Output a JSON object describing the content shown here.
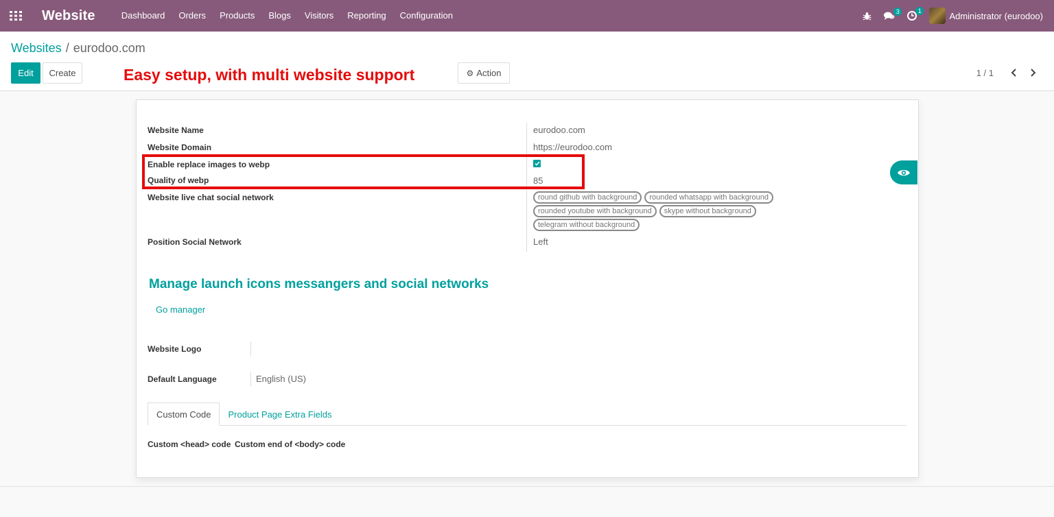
{
  "navbar": {
    "brand": "Website",
    "menu": [
      "Dashboard",
      "Orders",
      "Products",
      "Blogs",
      "Visitors",
      "Reporting",
      "Configuration"
    ],
    "messages_count": "3",
    "activities_count": "1",
    "user": "Administrator (eurodoo)"
  },
  "control_panel": {
    "breadcrumb_parent": "Websites",
    "breadcrumb_sep": "/",
    "breadcrumb_current": "eurodoo.com",
    "edit_label": "Edit",
    "create_label": "Create",
    "promo_text": "Easy setup, with multi website support",
    "action_label": "Action",
    "pager": "1 / 1"
  },
  "form": {
    "fields": [
      {
        "label": "Website Name",
        "value": "eurodoo.com"
      },
      {
        "label": "Website Domain",
        "value": "https://eurodoo.com"
      },
      {
        "label": "Enable replace images to webp",
        "checked": true
      },
      {
        "label": "Quality of webp",
        "value": "85"
      },
      {
        "label": "Website live chat social network"
      },
      {
        "label": "Position Social Network",
        "value": "Left"
      }
    ],
    "social_tags": [
      "round github with background",
      "rounded whatsapp with background",
      "rounded youtube with background",
      "skype without background",
      "telegram without background"
    ],
    "section_title": "Manage launch icons messangers and social networks",
    "go_manager": "Go manager",
    "logo_label": "Website Logo",
    "language_label": "Default Language",
    "language_value": "English (US)",
    "tabs": [
      "Custom Code",
      "Product Page Extra Fields"
    ],
    "custom_head": "Custom <head> code",
    "custom_body": "Custom end of <body> code"
  },
  "colors": {
    "navbar": "#875a7b",
    "accent": "#00a09d",
    "highlight": "#e50b0b"
  }
}
